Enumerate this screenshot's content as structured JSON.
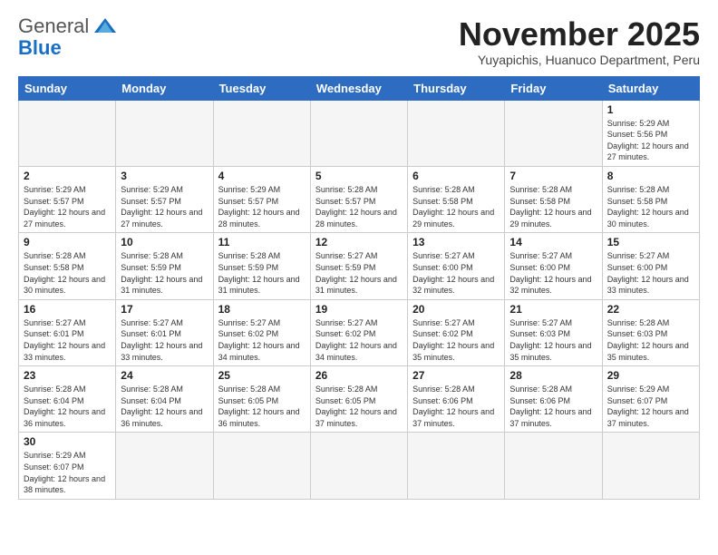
{
  "header": {
    "logo": {
      "general": "General",
      "blue": "Blue"
    },
    "title": "November 2025",
    "subtitle": "Yuyapichis, Huanuco Department, Peru"
  },
  "weekdays": [
    "Sunday",
    "Monday",
    "Tuesday",
    "Wednesday",
    "Thursday",
    "Friday",
    "Saturday"
  ],
  "days": {
    "1": {
      "sunrise": "5:29 AM",
      "sunset": "5:56 PM",
      "daylight": "12 hours and 27 minutes."
    },
    "2": {
      "sunrise": "5:29 AM",
      "sunset": "5:57 PM",
      "daylight": "12 hours and 27 minutes."
    },
    "3": {
      "sunrise": "5:29 AM",
      "sunset": "5:57 PM",
      "daylight": "12 hours and 27 minutes."
    },
    "4": {
      "sunrise": "5:29 AM",
      "sunset": "5:57 PM",
      "daylight": "12 hours and 28 minutes."
    },
    "5": {
      "sunrise": "5:28 AM",
      "sunset": "5:57 PM",
      "daylight": "12 hours and 28 minutes."
    },
    "6": {
      "sunrise": "5:28 AM",
      "sunset": "5:58 PM",
      "daylight": "12 hours and 29 minutes."
    },
    "7": {
      "sunrise": "5:28 AM",
      "sunset": "5:58 PM",
      "daylight": "12 hours and 29 minutes."
    },
    "8": {
      "sunrise": "5:28 AM",
      "sunset": "5:58 PM",
      "daylight": "12 hours and 30 minutes."
    },
    "9": {
      "sunrise": "5:28 AM",
      "sunset": "5:58 PM",
      "daylight": "12 hours and 30 minutes."
    },
    "10": {
      "sunrise": "5:28 AM",
      "sunset": "5:59 PM",
      "daylight": "12 hours and 31 minutes."
    },
    "11": {
      "sunrise": "5:28 AM",
      "sunset": "5:59 PM",
      "daylight": "12 hours and 31 minutes."
    },
    "12": {
      "sunrise": "5:27 AM",
      "sunset": "5:59 PM",
      "daylight": "12 hours and 31 minutes."
    },
    "13": {
      "sunrise": "5:27 AM",
      "sunset": "6:00 PM",
      "daylight": "12 hours and 32 minutes."
    },
    "14": {
      "sunrise": "5:27 AM",
      "sunset": "6:00 PM",
      "daylight": "12 hours and 32 minutes."
    },
    "15": {
      "sunrise": "5:27 AM",
      "sunset": "6:00 PM",
      "daylight": "12 hours and 33 minutes."
    },
    "16": {
      "sunrise": "5:27 AM",
      "sunset": "6:01 PM",
      "daylight": "12 hours and 33 minutes."
    },
    "17": {
      "sunrise": "5:27 AM",
      "sunset": "6:01 PM",
      "daylight": "12 hours and 33 minutes."
    },
    "18": {
      "sunrise": "5:27 AM",
      "sunset": "6:02 PM",
      "daylight": "12 hours and 34 minutes."
    },
    "19": {
      "sunrise": "5:27 AM",
      "sunset": "6:02 PM",
      "daylight": "12 hours and 34 minutes."
    },
    "20": {
      "sunrise": "5:27 AM",
      "sunset": "6:02 PM",
      "daylight": "12 hours and 35 minutes."
    },
    "21": {
      "sunrise": "5:27 AM",
      "sunset": "6:03 PM",
      "daylight": "12 hours and 35 minutes."
    },
    "22": {
      "sunrise": "5:28 AM",
      "sunset": "6:03 PM",
      "daylight": "12 hours and 35 minutes."
    },
    "23": {
      "sunrise": "5:28 AM",
      "sunset": "6:04 PM",
      "daylight": "12 hours and 36 minutes."
    },
    "24": {
      "sunrise": "5:28 AM",
      "sunset": "6:04 PM",
      "daylight": "12 hours and 36 minutes."
    },
    "25": {
      "sunrise": "5:28 AM",
      "sunset": "6:05 PM",
      "daylight": "12 hours and 36 minutes."
    },
    "26": {
      "sunrise": "5:28 AM",
      "sunset": "6:05 PM",
      "daylight": "12 hours and 37 minutes."
    },
    "27": {
      "sunrise": "5:28 AM",
      "sunset": "6:06 PM",
      "daylight": "12 hours and 37 minutes."
    },
    "28": {
      "sunrise": "5:28 AM",
      "sunset": "6:06 PM",
      "daylight": "12 hours and 37 minutes."
    },
    "29": {
      "sunrise": "5:29 AM",
      "sunset": "6:07 PM",
      "daylight": "12 hours and 37 minutes."
    },
    "30": {
      "sunrise": "5:29 AM",
      "sunset": "6:07 PM",
      "daylight": "12 hours and 38 minutes."
    }
  }
}
